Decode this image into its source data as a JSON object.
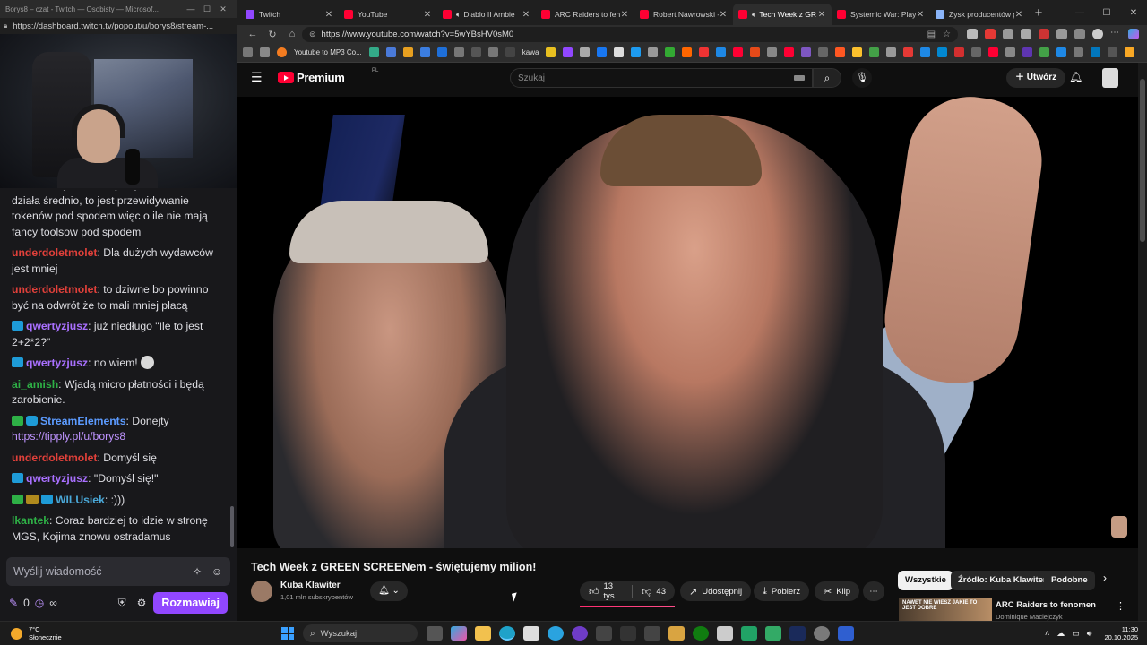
{
  "twitch_window": {
    "title": "Borys8 – czat - Twitch — Osobisty — Microsof...",
    "url": "https://dashboard.twitch.tv/popout/u/borys8/stream-..."
  },
  "chat": {
    "messages": [
      {
        "user": "lkantek",
        "color": "#2eb046",
        "text": "Oj, matematyka jak coś w LLMach działa średnio, to jest przewidywanie tokenów pod spodem więc o ile nie mają fancy toolsow pod spodem",
        "badges": []
      },
      {
        "user": "underdoletmolet",
        "color": "#e0403a",
        "text": "Dla dużych wydawców jest mniej",
        "badges": []
      },
      {
        "user": "underdoletmolet",
        "color": "#e0403a",
        "text": "to dziwne bo powinno być na odwrót że to mali mniej płacą",
        "badges": []
      },
      {
        "user": "qwertyzjusz",
        "color": "#a970ff",
        "text": "już niedługo \"Ile to jest 2+2*2?\"",
        "badges": [
          "sub"
        ]
      },
      {
        "user": "qwertyzjusz",
        "color": "#a970ff",
        "text": "no wiem!",
        "badges": [
          "sub"
        ],
        "emote": true
      },
      {
        "user": "ai_amish",
        "color": "#2eb046",
        "text": "Wjadą micro płatności i będą zarobienie.",
        "badges": []
      },
      {
        "user": "StreamElements",
        "color": "#5c9bff",
        "text": "Donejty ",
        "link": "https://tipply.pl/u/borys8",
        "badges": [
          "ver",
          "bot"
        ]
      },
      {
        "user": "underdoletmolet",
        "color": "#e0403a",
        "text": "Domyśl się",
        "badges": []
      },
      {
        "user": "qwertyzjusz",
        "color": "#a970ff",
        "text": "\"Domyśl się!\"",
        "badges": [
          "sub"
        ]
      },
      {
        "user": "WILUsiek",
        "color": "#4aa8d8",
        "text": ":)))",
        "badges": [
          "ver",
          "rck",
          "sub"
        ]
      },
      {
        "user": "lkantek",
        "color": "#2eb046",
        "text": "Coraz bardziej to idzie w stronę MGS, Kojima znowu ostradamus",
        "badges": []
      }
    ],
    "input_placeholder": "Wyślij wiadomość",
    "points": "0",
    "infinity": "∞",
    "send_label": "Rozmawiaj"
  },
  "browser": {
    "tabs": [
      {
        "title": "Twitch",
        "color": "#9147ff",
        "active": false,
        "speaker": false
      },
      {
        "title": "YouTube",
        "color": "#ff0033",
        "active": false,
        "speaker": false
      },
      {
        "title": "Diablo II Ambie",
        "color": "#ff0033",
        "active": false,
        "speaker": true
      },
      {
        "title": "ARC Raiders to fenom",
        "color": "#ff0033",
        "active": false,
        "speaker": false
      },
      {
        "title": "Robert Nawrowski - Y",
        "color": "#ff0033",
        "active": false,
        "speaker": false
      },
      {
        "title": "Tech Week z GR",
        "color": "#ff0033",
        "active": true,
        "speaker": true
      },
      {
        "title": "Systemic War: Play of",
        "color": "#ff0033",
        "active": false,
        "speaker": false
      },
      {
        "title": "Zysk producentów gr",
        "color": "#8ab4f8",
        "active": false,
        "speaker": false
      }
    ],
    "url": "https://www.youtube.com/watch?v=5wYBsHV0sM0",
    "bookmarks": [
      "Youtube to MP3 Co...",
      "kawa"
    ]
  },
  "youtube": {
    "logo_word": "Premium",
    "logo_region": "PL",
    "search_placeholder": "Szukaj",
    "create_label": "Utwórz",
    "video_title": "Tech Week z GREEN SCREENem - świętujemy milion!",
    "channel_name": "Kuba Klawiter",
    "channel_subs": "1,01 mln subskrybentów",
    "likes": "13 tys.",
    "dislikes": "43",
    "share_label": "Udostępnij",
    "download_label": "Pobierz",
    "clip_label": "Klip",
    "chips": [
      "Wszystkie",
      "Źródło: Kuba Klawiter",
      "Podobne"
    ],
    "rec_title": "ARC Raiders to fenomen",
    "rec_channel": "Dominique Maciejczyk",
    "rec_thumb_text": "NAWET NIE WIESZ JAKIE TO JEST DOBRE"
  },
  "taskbar": {
    "temperature": "7°C",
    "weather": "Słonecznie",
    "search_label": "Wyszukaj",
    "time": "11:30",
    "date": "20.10.2025"
  }
}
